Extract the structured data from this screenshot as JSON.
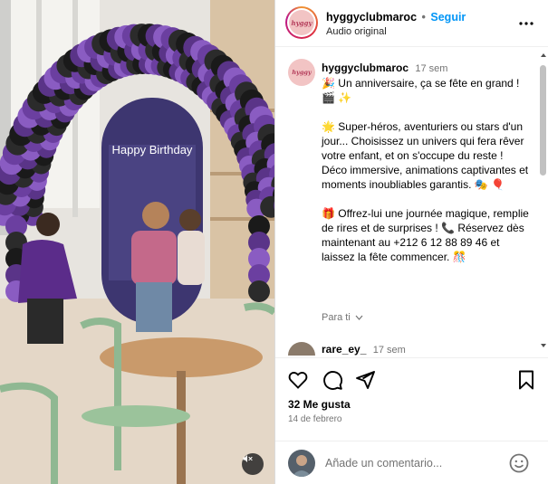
{
  "media": {
    "banner_text": "Happy Birthday",
    "mute_icon": "speaker-muted-icon"
  },
  "header": {
    "username": "hyggyclubmaroc",
    "separator": "•",
    "follow_label": "Seguir",
    "audio_label": "Audio original",
    "more_icon": "more-horizontal-icon"
  },
  "caption": {
    "username": "hyggyclubmaroc",
    "time": "17 sem",
    "line1": "🎉 Un anniversaire, ça se fête en grand ! 🎬 ✨",
    "line2": "🌟 Super-héros, aventuriers ou stars d'un jour... Choisissez un univers qui fera rêver votre enfant, et on s'occupe du reste ! Déco immersive, animations captivantes et moments inoubliables garantis. 🎭 🎈",
    "line3": "🎁 Offrez-lui une journée magique, remplie de rires et de surprises ! 📞 Réservez dès maintenant au +212 6 12 88 89 46 et laissez la fête commencer. 🎊",
    "translate_label": "Para ti"
  },
  "comment2": {
    "username": "rare_ey_",
    "time": "17 sem"
  },
  "actions": {
    "likes": "32 Me gusta",
    "date": "14 de febrero"
  },
  "add_comment": {
    "placeholder": "Añade un comentario..."
  },
  "colors": {
    "accent": "#0095f6",
    "secondary_text": "#737373",
    "border": "#dbdbdb",
    "balloon_purple": "#6b3fa0",
    "balloon_black": "#1a1a1a"
  }
}
